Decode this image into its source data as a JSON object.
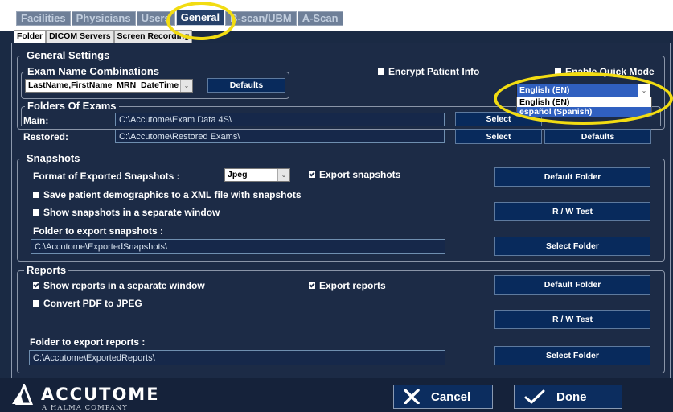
{
  "tabs": [
    {
      "label": "Facilities"
    },
    {
      "label": "Physicians"
    },
    {
      "label": "Users"
    },
    {
      "label": "General"
    },
    {
      "label": "B-scan/UBM"
    },
    {
      "label": "A-Scan"
    }
  ],
  "subtabs": [
    {
      "label": "Folder"
    },
    {
      "label": "DICOM Servers"
    },
    {
      "label": "Screen Recording"
    }
  ],
  "general_settings": {
    "legend": "General Settings",
    "exam_name_legend": "Exam Name Combinations",
    "exam_name_value": "LastName,FirstName_MRN_DateTime",
    "defaults_label": "Defaults",
    "encrypt_label": "Encrypt Patient Info",
    "quick_mode_label": "Enable Quick Mode",
    "language_selected": "English (EN)",
    "language_options": [
      "English (EN)",
      "español (Spanish)"
    ],
    "folders_legend": "Folders Of Exams",
    "main_label": "Main:",
    "main_path": "C:\\Accutome\\Exam Data 4S\\",
    "restored_label": "Restored:",
    "restored_path": "C:\\Accutome\\Restored Exams\\",
    "select_label": "Select",
    "defaults_btn_label": "Defaults"
  },
  "snapshots": {
    "legend": "Snapshots",
    "format_label": "Format of Exported Snapshots :",
    "format_value": "Jpeg",
    "export_label": "Export snapshots",
    "export_checked": true,
    "xml_label": "Save patient demographics to a XML file with snapshots",
    "separate_label": "Show snapshots in a separate window",
    "default_folder_label": "Default Folder",
    "rw_test_label": "R / W Test",
    "folder_label": "Folder to export snapshots :",
    "folder_path": "C:\\Accutome\\ExportedSnapshots\\",
    "select_folder_label": "Select Folder"
  },
  "reports": {
    "legend": "Reports",
    "separate_label": "Show reports in a separate window",
    "separate_checked": true,
    "export_label": "Export reports",
    "export_checked": true,
    "pdf_label": "Convert PDF to JPEG",
    "default_folder_label": "Default Folder",
    "rw_test_label": "R / W Test",
    "folder_label": "Folder to export reports :",
    "folder_path": "C:\\Accutome\\ExportedReports\\",
    "select_folder_label": "Select Folder"
  },
  "footer": {
    "brand": "ACCUTOME",
    "brand_sub": "A HALMA COMPANY",
    "cancel_label": "Cancel",
    "done_label": "Done"
  },
  "colors": {
    "background": "#1c2b46",
    "button": "#082a5c",
    "highlight": "#f2dc12",
    "dropdown_selection": "#3060c0"
  }
}
